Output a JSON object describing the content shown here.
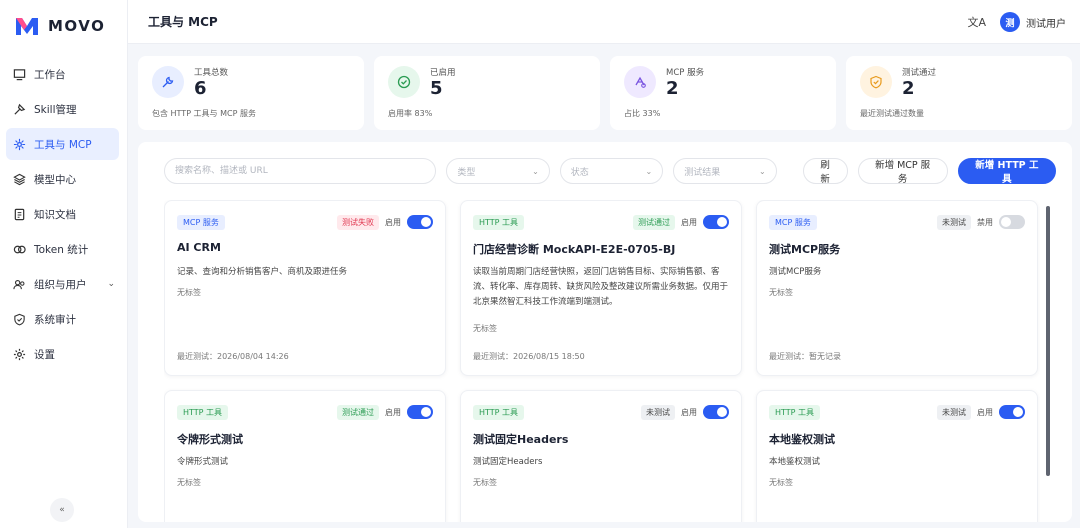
{
  "sidebar": {
    "logo_text": "MOVO",
    "items": [
      {
        "label": "工作台",
        "icon": "dashboard-icon"
      },
      {
        "label": "Skill管理",
        "icon": "skill-icon"
      },
      {
        "label": "工具与 MCP",
        "icon": "tools-icon",
        "active": true
      },
      {
        "label": "模型中心",
        "icon": "model-icon"
      },
      {
        "label": "知识文档",
        "icon": "document-icon"
      },
      {
        "label": "Token 统计",
        "icon": "token-icon"
      },
      {
        "label": "组织与用户",
        "icon": "users-icon",
        "expandable": true
      },
      {
        "label": "系统审计",
        "icon": "shield-icon"
      },
      {
        "label": "设置",
        "icon": "gear-icon"
      }
    ],
    "collapse_glyph": "«"
  },
  "header": {
    "title": "工具与 MCP",
    "translate_glyph": "文A",
    "user_initial": "测",
    "user_name": "测试用户"
  },
  "stats": [
    {
      "label": "工具总数",
      "value": "6",
      "sub": "包含 HTTP 工具与 MCP 服务",
      "color": "#2b5cf2",
      "bg": "#e8eeff"
    },
    {
      "label": "已启用",
      "value": "5",
      "sub": "启用率 83%",
      "color": "#2a9b52",
      "bg": "#e6f7ec"
    },
    {
      "label": "MCP 服务",
      "value": "2",
      "sub": "占比 33%",
      "color": "#7a55e0",
      "bg": "#efe9ff"
    },
    {
      "label": "测试通过",
      "value": "2",
      "sub": "最近测试通过数量",
      "color": "#e89a1c",
      "bg": "#fff3e0"
    }
  ],
  "filters": {
    "search_placeholder": "搜索名称、描述或 URL",
    "type_placeholder": "类型",
    "status_placeholder": "状态",
    "result_placeholder": "测试结果",
    "refresh_label": "刷新",
    "add_mcp_label": "新增 MCP 服务",
    "add_http_label": "新增 HTTP 工具"
  },
  "cards": [
    {
      "type": "MCP 服务",
      "kind": "mcp",
      "test": "测试失败",
      "test_kind": "fail",
      "enable_label": "启用",
      "enabled": true,
      "name": "AI CRM",
      "desc": "记录、查询和分析销售客户、商机及跟进任务",
      "tags": "无标签",
      "last": "最近测试：2026/08/04 14:26"
    },
    {
      "type": "HTTP 工具",
      "kind": "http",
      "test": "测试通过",
      "test_kind": "pass",
      "enable_label": "启用",
      "enabled": true,
      "name": "门店经营诊断 MockAPI-E2E-0705-BJ",
      "desc": "读取当前周期门店经营快照，返回门店销售目标、实际销售额、客流、转化率、库存周转、缺货风险及整改建议所需业务数据。仅用于北京果然智汇科技工作流端到端测试。",
      "tags": "无标签",
      "last": "最近测试：2026/08/15 18:50"
    },
    {
      "type": "MCP 服务",
      "kind": "mcp",
      "test": "未测试",
      "test_kind": "none",
      "enable_label": "禁用",
      "enabled": false,
      "name": "测试MCP服务",
      "desc": "测试MCP服务",
      "tags": "无标签",
      "last": "最近测试：暂无记录"
    },
    {
      "type": "HTTP 工具",
      "kind": "http",
      "test": "测试通过",
      "test_kind": "pass",
      "enable_label": "启用",
      "enabled": true,
      "name": "令牌形式测试",
      "desc": "令牌形式测试",
      "tags": "无标签",
      "last": ""
    },
    {
      "type": "HTTP 工具",
      "kind": "http",
      "test": "未测试",
      "test_kind": "none",
      "enable_label": "启用",
      "enabled": true,
      "name": "测试固定Headers",
      "desc": "测试固定Headers",
      "tags": "无标签",
      "last": ""
    },
    {
      "type": "HTTP 工具",
      "kind": "http",
      "test": "未测试",
      "test_kind": "none",
      "enable_label": "启用",
      "enabled": true,
      "name": "本地鉴权测试",
      "desc": "本地鉴权测试",
      "tags": "无标签",
      "last": ""
    }
  ]
}
